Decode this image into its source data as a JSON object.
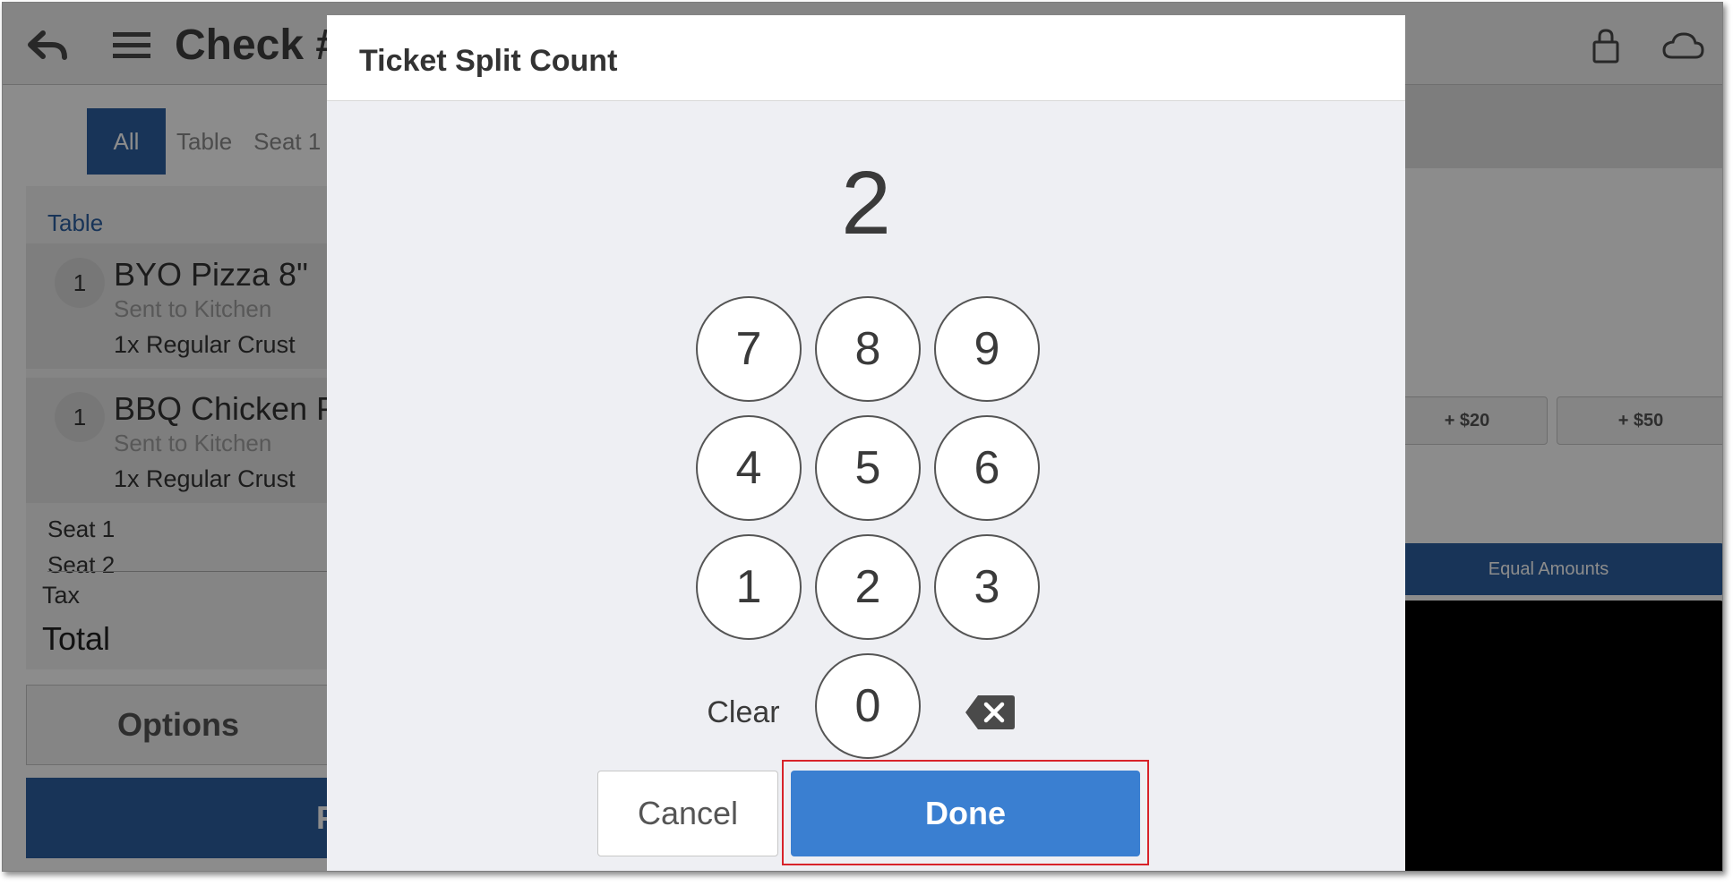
{
  "app": {
    "title": "Check #",
    "icons": {
      "back": "back-arrow-icon",
      "menu": "hamburger-menu-icon",
      "lock": "lock-icon",
      "cloud": "cloud-icon"
    }
  },
  "filters": {
    "all": "All",
    "table": "Table",
    "seat1": "Seat 1"
  },
  "order": {
    "section_label": "Table",
    "items": [
      {
        "qty": "1",
        "name": "BYO Pizza 8\"",
        "status": "Sent to Kitchen",
        "modifier": "1x  Regular Crust"
      },
      {
        "qty": "1",
        "name": "BBQ Chicken P",
        "status": "Sent to Kitchen",
        "modifier": "1x  Regular Crust"
      }
    ],
    "seats": [
      "Seat 1",
      "Seat 2"
    ],
    "tax_label": "Tax",
    "total_label": "Total"
  },
  "actions": {
    "options": "Options",
    "pay": "P"
  },
  "payment": {
    "amount_20": "+ $20",
    "amount_50": "+ $50",
    "equal_amounts": "Equal Amounts"
  },
  "dialog": {
    "title": "Ticket Split Count",
    "value": "2",
    "keys": {
      "k7": "7",
      "k8": "8",
      "k9": "9",
      "k4": "4",
      "k5": "5",
      "k6": "6",
      "k1": "1",
      "k2": "2",
      "k3": "3",
      "k0": "0"
    },
    "clear": "Clear",
    "backspace_icon": "backspace-icon",
    "cancel": "Cancel",
    "done": "Done"
  },
  "colors": {
    "brand_blue": "#2c5fa0",
    "done_blue": "#3a7fd1",
    "highlight_red": "#d8232a",
    "dialog_bg": "#eeeff3"
  }
}
